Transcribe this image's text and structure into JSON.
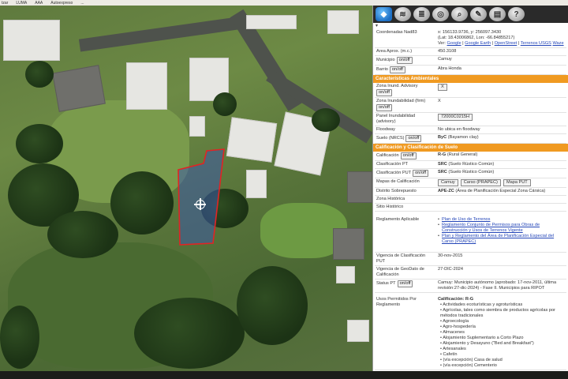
{
  "bookmarks": [
    "tzar",
    "LUMA",
    "AAA",
    "Autoexpreso",
    "..."
  ],
  "toolbar": {
    "icons": [
      "google-maps-icon",
      "layers-icon",
      "layers-stack-icon",
      "coins-icon",
      "search-icon",
      "edit-icon",
      "print-icon",
      "help-icon"
    ],
    "caret": "▾"
  },
  "info": {
    "coords_label": "Coordenadas Nad83",
    "coords_value": "x: 156133.9736, y: 256097.3430",
    "latlon_value": "(Lat: 18.43006862, Lon: -66.84855217)",
    "ver_label": "Ver:",
    "ver_links": [
      "Google",
      "Google Earth",
      "OpenStreet",
      "Terrenos USGS",
      "Waze"
    ],
    "area_label": "Area Aprox. (m.c.)",
    "area_value": "450.3108",
    "municipio_label": "Municipio",
    "municipio_value": "Camuy",
    "barrio_label": "Barrio",
    "barrio_value": "Abra Honda",
    "onoff": "on/off"
  },
  "ambientales": {
    "title": "Características Ambientales",
    "inund_label": "Zona Inund. Advisory",
    "inund_value": "X",
    "inund_firm_label": "Zona Inundabilidad (firm)",
    "inund_firm_value": "X",
    "panel_label": "Panel Inundabilidad (advisory)",
    "panel_value": "72000C0215H",
    "floodway_label": "Floodway",
    "floodway_value": "No ubica en floodway",
    "suelo_label": "Suelo (NRCS)",
    "suelo_value_bold": "ByC",
    "suelo_value": "(Bayamon clay)"
  },
  "calificacion": {
    "title": "Calificación y Clasificación de Suelo",
    "calif_label": "Calificación",
    "calif_bold": "R-G",
    "calif_value": "(Rural General)",
    "clasif_pt_label": "Clasificación PT",
    "clasif_pt_bold": "SRC",
    "clasif_pt_value": "(Suelo Rústico Común)",
    "clasif_put_label": "Clasificación PUT",
    "clasif_put_bold": "SRC",
    "clasif_put_value": "(Suelo Rústico Común)",
    "mapas_label": "Mapas de Calificación",
    "mapas_buttons": [
      "Camuy",
      "Carso (PRAPEC)",
      "Mapa PUT"
    ],
    "distrito_label": "Distrito Sobrepuesto",
    "distrito_bold": "APE-ZC",
    "distrito_value": "(Área de Planificación Especial Zona Cársica)",
    "historica_label": "Zona Histórica",
    "sitio_label": "Sitio Histórico",
    "reglamento_label": "Reglamento Aplicable",
    "reglamentos": [
      "Plan de Uso de Terrenos",
      "Reglamento Conjunto de Permisos para Obras de Construcción y Usos de Terrenos Vigente",
      "Plan y Reglamento del Área de Planificación Especial del Carso (PRAPEC)"
    ],
    "vigencia_put_label": "Vigencia de Clasificación PUT",
    "vigencia_put_value": "30-nov-2015",
    "vigencia_geo_label": "Vigencia de GeoDato de Calificación",
    "vigencia_geo_value": "27-DIC-2024",
    "status_label": "Status PT",
    "status_value": "Camuy: Municipio autónomo (aprobado: 17-nov-2011, última revisión:27-dic-2024) - Fase II. Municipios para RIPOT",
    "usos_label": "Usos Permitidos Por Reglamento",
    "usos_title": "Calificación: R-G",
    "usos": [
      "• Actividades ecoturísticas y agroturísticas",
      "• Agrícolas, tales como siembra de productos agrícolas por métodos tradicionales",
      "• Agroecología",
      "• Agro-hospedería",
      "• Almacenes",
      "• Alojamiento Suplementario a Corto Plazo",
      "• Alojamiento y Desayuno (\"Bed and Breakfast\")",
      "• Artesanales",
      "• Cafetín",
      "• (vía excepción) Casa de salud",
      "• (vía excepción) Cementerio"
    ]
  }
}
